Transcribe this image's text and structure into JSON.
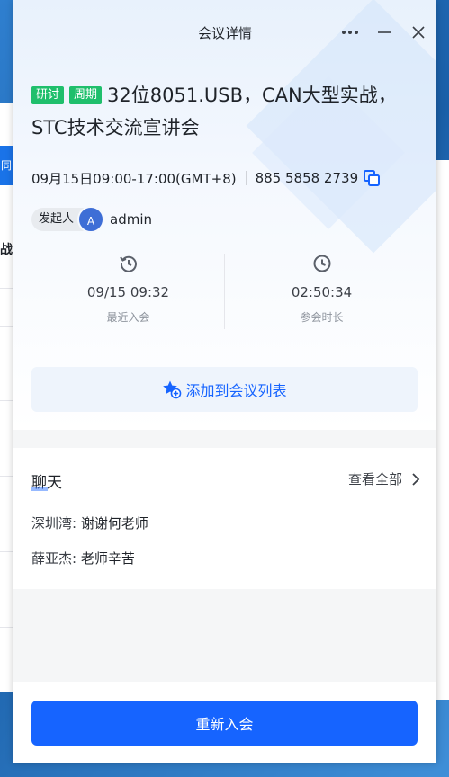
{
  "background": {
    "tab_hint": "同",
    "text_hint": "战"
  },
  "window": {
    "title": "会议详情"
  },
  "meeting": {
    "tags": [
      "研讨",
      "周期"
    ],
    "title": "32位8051.USB，CAN大型实战，STC技术交流宣讲会",
    "time": "09月15日09:00-17:00(GMT+8)",
    "meeting_id": "885 5858 2739"
  },
  "host": {
    "label": "发起人",
    "avatar_letter": "A",
    "name": "admin"
  },
  "stats": [
    {
      "icon": "history-icon",
      "value": "09/15 09:32",
      "label": "最近入会"
    },
    {
      "icon": "clock-icon",
      "value": "02:50:34",
      "label": "参会时长"
    }
  ],
  "actions": {
    "add_to_list": "添加到会议列表",
    "rejoin": "重新入会"
  },
  "chat": {
    "title": "聊天",
    "view_all": "查看全部",
    "messages": [
      {
        "sender": "深圳湾:",
        "text": " 谢谢何老师"
      },
      {
        "sender": "薛亚杰:",
        "text": " 老师辛苦"
      }
    ]
  },
  "colors": {
    "accent": "#1664ff",
    "tag": "#1fbf6c",
    "avatar": "#3e6ed6"
  }
}
